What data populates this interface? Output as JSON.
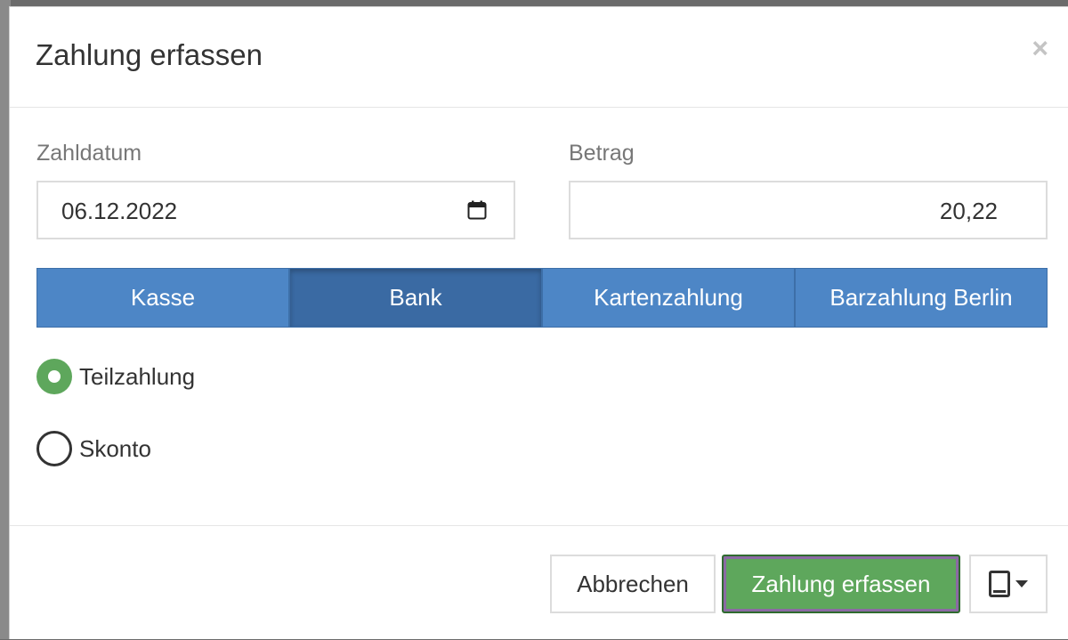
{
  "dialog": {
    "title": "Zahlung erfassen",
    "close_label": "×"
  },
  "form": {
    "date_label": "Zahldatum",
    "date_value": "06.12.2022",
    "amount_label": "Betrag",
    "amount_value": "20,22"
  },
  "payment_methods": [
    {
      "label": "Kasse",
      "active": false
    },
    {
      "label": "Bank",
      "active": true
    },
    {
      "label": "Kartenzahlung",
      "active": false
    },
    {
      "label": "Barzahlung Berlin",
      "active": false
    }
  ],
  "payment_type": {
    "options": [
      {
        "label": "Teilzahlung",
        "checked": true
      },
      {
        "label": "Skonto",
        "checked": false
      }
    ]
  },
  "footer": {
    "cancel_label": "Abbrechen",
    "submit_label": "Zahlung erfassen",
    "device_icon": "tablet-icon"
  },
  "colors": {
    "segment": "#4d86c6",
    "segment_active": "#3a6aa3",
    "success": "#5ea75c"
  }
}
